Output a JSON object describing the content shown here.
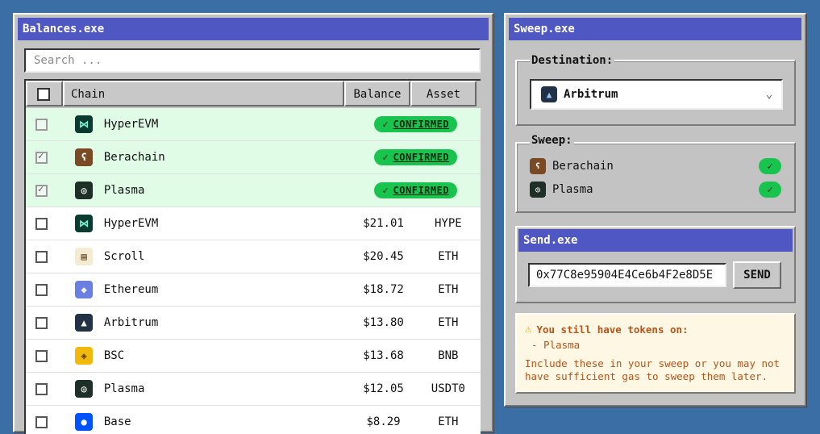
{
  "balances_window": {
    "title": "Balances.exe",
    "search_placeholder": "Search ...",
    "columns": {
      "chain": "Chain",
      "balance": "Balance",
      "asset": "Asset"
    },
    "rows": [
      {
        "chain": "HyperEVM",
        "status": "CONFIRMED",
        "checked": false,
        "icon": "hyperevm-icon",
        "color": "#0b3b30"
      },
      {
        "chain": "Berachain",
        "status": "CONFIRMED",
        "checked": true,
        "icon": "berachain-icon",
        "color": "#7a4a25"
      },
      {
        "chain": "Plasma",
        "status": "CONFIRMED",
        "checked": true,
        "icon": "plasma-icon",
        "color": "#1d2f27"
      },
      {
        "chain": "HyperEVM",
        "balance": "$21.01",
        "asset": "HYPE",
        "checked": false,
        "icon": "hyperevm-icon",
        "color": "#0b3b30"
      },
      {
        "chain": "Scroll",
        "balance": "$20.45",
        "asset": "ETH",
        "checked": false,
        "icon": "scroll-icon",
        "color": "#f5ead2"
      },
      {
        "chain": "Ethereum",
        "balance": "$18.72",
        "asset": "ETH",
        "checked": false,
        "icon": "ethereum-icon",
        "color": "#6b7fe0"
      },
      {
        "chain": "Arbitrum",
        "balance": "$13.80",
        "asset": "ETH",
        "checked": false,
        "icon": "arbitrum-icon",
        "color": "#213147"
      },
      {
        "chain": "BSC",
        "balance": "$13.68",
        "asset": "BNB",
        "checked": false,
        "icon": "bsc-icon",
        "color": "#f0b90b"
      },
      {
        "chain": "Plasma",
        "balance": "$12.05",
        "asset": "USDT0",
        "checked": false,
        "icon": "plasma-icon",
        "color": "#1d2f27"
      },
      {
        "chain": "Base",
        "balance": "$8.29",
        "asset": "ETH",
        "checked": false,
        "icon": "base-icon",
        "color": "#0052ff"
      }
    ]
  },
  "sweep_window": {
    "title": "Sweep.exe",
    "destination_label": "Destination:",
    "destination_value": "Arbitrum",
    "sweep_label": "Sweep:",
    "sweep_items": [
      {
        "name": "Berachain",
        "icon": "berachain-icon",
        "color": "#7a4a25"
      },
      {
        "name": "Plasma",
        "icon": "plasma-icon",
        "color": "#1d2f27"
      }
    ],
    "send": {
      "title": "Send.exe",
      "address": "0x77C8e95904E4Ce6b4F2e8D5E",
      "button": "SEND"
    },
    "warning": {
      "title": "You still have tokens on:",
      "items": [
        "- Plasma"
      ],
      "message": "Include these in your sweep or you may not have sufficient gas to sweep them later."
    }
  },
  "colors": {
    "desktop": "#3a6ea5",
    "titlebar": "#4f57c3",
    "confirmed_row": "#e0fbe6",
    "badge_green": "#18c44e",
    "warning_text": "#b5541b",
    "warning_bg": "#fdf7e3"
  }
}
